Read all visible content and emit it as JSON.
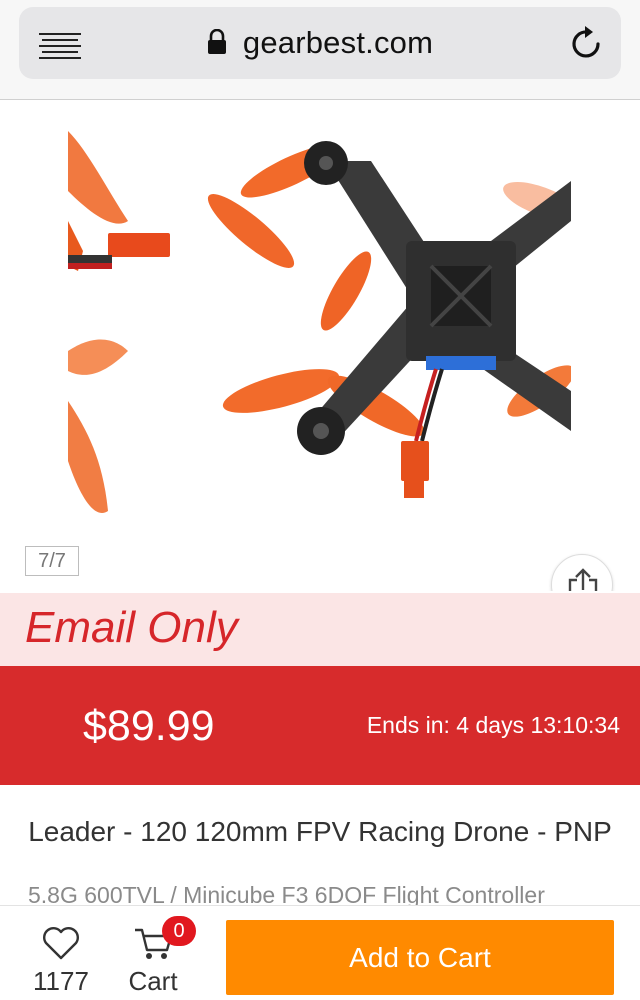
{
  "browser": {
    "url": "gearbest.com",
    "icons": {
      "menu": "menu-icon",
      "lock": "lock-icon",
      "reload": "reload-icon"
    }
  },
  "gallery": {
    "page_indicator": "7/7",
    "share_icon": "share-icon"
  },
  "promo": {
    "email_only": "Email Only",
    "price": "$89.99",
    "ends_in": "Ends in: 4 days 13:10:34",
    "accent_color": "#d72b2c",
    "email_band_color": "#fbe5e5"
  },
  "product": {
    "title": "Leader - 120 120mm FPV Racing Drone - PNP",
    "subtitle": "5.8G 600TVL / Minicube F3 6DOF Flight Controller"
  },
  "bottom_bar": {
    "favorites_count": "1177",
    "cart_label": "Cart",
    "cart_badge": "0",
    "add_to_cart": "Add to Cart",
    "add_to_cart_color": "#ff8a00"
  }
}
